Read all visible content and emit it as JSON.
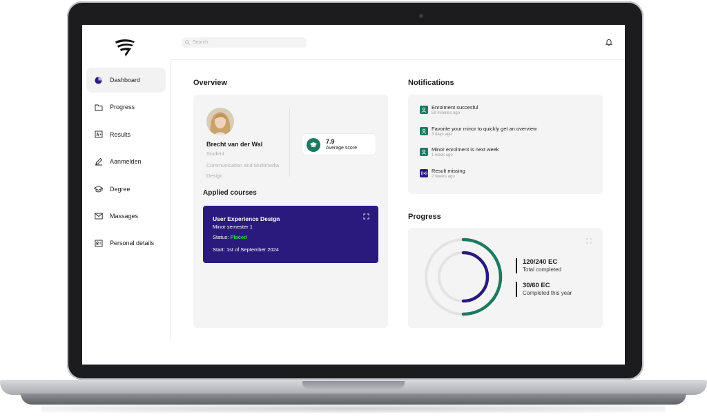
{
  "search": {
    "placeholder": "Search"
  },
  "sidebar": {
    "items": [
      {
        "label": "Dashboard",
        "icon": "dashboard-icon",
        "active": true
      },
      {
        "label": "Progress",
        "icon": "folder-icon"
      },
      {
        "label": "Results",
        "icon": "results-icon"
      },
      {
        "label": "Aanmelden",
        "icon": "pencil-icon"
      },
      {
        "label": "Degree",
        "icon": "graduation-cap-icon"
      },
      {
        "label": "Massages",
        "icon": "mail-icon"
      },
      {
        "label": "Personal details",
        "icon": "id-card-icon"
      }
    ]
  },
  "overview": {
    "title": "Overview",
    "student": {
      "name": "Brecht van der Wal",
      "role": "Student",
      "program": "Communication and Multimedia Design"
    },
    "score": {
      "value": "7.9",
      "label": "Average score"
    }
  },
  "applied": {
    "title": "Applied courses",
    "course": {
      "title": "User Experience Design",
      "semester": "Minor semester 1",
      "status_label": "Status:",
      "status_value": "Placed",
      "start": "Start: 1st of September 2024"
    }
  },
  "notifications": {
    "title": "Notifications",
    "items": [
      {
        "text": "Enrolment succesful",
        "time": "59 minutes ago",
        "color": "#1b7a5f"
      },
      {
        "text": "Favorite your minor to quickly get an overview",
        "time": "3 days ago",
        "color": "#1b7a5f"
      },
      {
        "text": "Minor enrolment is next week",
        "time": "1 week ago",
        "color": "#1b7a5f"
      },
      {
        "text": "Result missing",
        "time": "2 weeks ago",
        "color": "#2b1a7e"
      }
    ]
  },
  "progress": {
    "title": "Progress",
    "total": {
      "value": "120/240 EC",
      "label": "Total completed",
      "fraction": 0.5,
      "color": "#1b7a5f"
    },
    "year": {
      "value": "30/60 EC",
      "label": "Completed this year",
      "fraction": 0.5,
      "color": "#2b1a7e"
    }
  }
}
